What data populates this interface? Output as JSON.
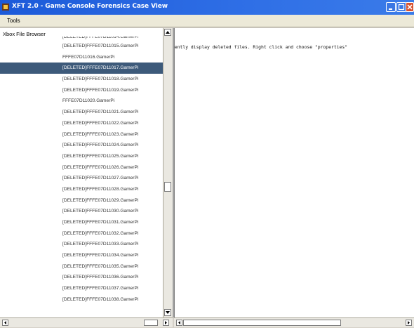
{
  "window": {
    "title": "XFT 2.0 - Game Console Forensics Case View"
  },
  "menu": {
    "tools_label": "Tools"
  },
  "file_browser": {
    "title": "Xbox File Browser",
    "items": [
      {
        "label": "[DELETED]FFFE07D11014.GamerPi",
        "deleted": true,
        "selected": false
      },
      {
        "label": "[DELETED]FFFE07D11015.GamerPi",
        "deleted": true,
        "selected": false
      },
      {
        "label": "FFFE07D11016.GamerPi",
        "deleted": false,
        "selected": false
      },
      {
        "label": "[DELETED]FFFE07D11017.GamerPi",
        "deleted": true,
        "selected": true
      },
      {
        "label": "[DELETED]FFFE07D11018.GamerPi",
        "deleted": true,
        "selected": false
      },
      {
        "label": "[DELETED]FFFE07D11019.GamerPi",
        "deleted": true,
        "selected": false
      },
      {
        "label": "FFFE07D11020.GamerPi",
        "deleted": false,
        "selected": false
      },
      {
        "label": "[DELETED]FFFE07D11021.GamerPi",
        "deleted": true,
        "selected": false
      },
      {
        "label": "[DELETED]FFFE07D11022.GamerPi",
        "deleted": true,
        "selected": false
      },
      {
        "label": "[DELETED]FFFE07D11023.GamerPi",
        "deleted": true,
        "selected": false
      },
      {
        "label": "[DELETED]FFFE07D11024.GamerPi",
        "deleted": true,
        "selected": false
      },
      {
        "label": "[DELETED]FFFE07D11025.GamerPi",
        "deleted": true,
        "selected": false
      },
      {
        "label": "[DELETED]FFFE07D11026.GamerPi",
        "deleted": true,
        "selected": false
      },
      {
        "label": "[DELETED]FFFE07D11027.GamerPi",
        "deleted": true,
        "selected": false
      },
      {
        "label": "[DELETED]FFFE07D11028.GamerPi",
        "deleted": true,
        "selected": false
      },
      {
        "label": "[DELETED]FFFE07D11029.GamerPi",
        "deleted": true,
        "selected": false
      },
      {
        "label": "[DELETED]FFFE07D11030.GamerPi",
        "deleted": true,
        "selected": false
      },
      {
        "label": "[DELETED]FFFE07D11031.GamerPi",
        "deleted": true,
        "selected": false
      },
      {
        "label": "[DELETED]FFFE07D11032.GamerPi",
        "deleted": true,
        "selected": false
      },
      {
        "label": "[DELETED]FFFE07D11033.GamerPi",
        "deleted": true,
        "selected": false
      },
      {
        "label": "[DELETED]FFFE07D11034.GamerPi",
        "deleted": true,
        "selected": false
      },
      {
        "label": "[DELETED]FFFE07D11035.GamerPi",
        "deleted": true,
        "selected": false
      },
      {
        "label": "[DELETED]FFFE07D11036.GamerPi",
        "deleted": true,
        "selected": false
      },
      {
        "label": "[DELETED]FFFE07D11037.GamerPi",
        "deleted": true,
        "selected": false
      },
      {
        "label": "[DELETED]FFFE07D11038.GamerPi",
        "deleted": true,
        "selected": false
      }
    ]
  },
  "detail_pane": {
    "message": "rently display deleted files.  Right click and choose \"properties\""
  },
  "colors": {
    "titlebar": "#1c5ad9",
    "selected_row": "#3d5a7a",
    "close_button": "#d8502e"
  }
}
